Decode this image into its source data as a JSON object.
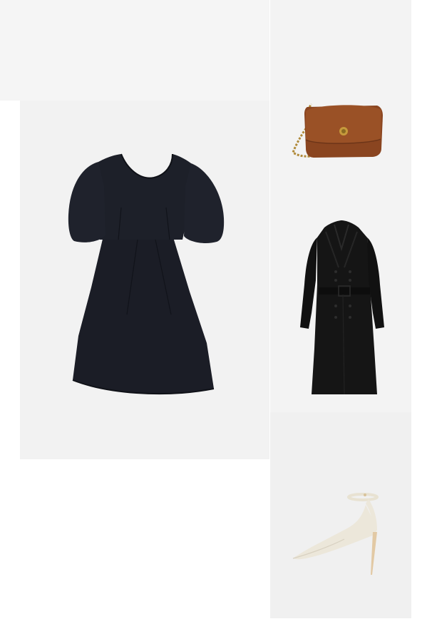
{
  "collage": {
    "items": [
      {
        "id": "dress",
        "icon": "black-dress-icon",
        "colors": {
          "garment": "#1b1d26",
          "background": "#f2f2f2"
        }
      },
      {
        "id": "bag",
        "icon": "brown-handbag-icon",
        "colors": {
          "leather": "#8a4520",
          "chain": "#b08a3a",
          "background": "#f3f3f3"
        }
      },
      {
        "id": "coat",
        "icon": "black-trench-coat-icon",
        "colors": {
          "garment": "#141414",
          "background": "#f3f3f3"
        }
      },
      {
        "id": "shoe",
        "icon": "ivory-pump-icon",
        "colors": {
          "leather": "#ece7da",
          "heel": "#e2c9a4",
          "background": "#f0f0f0"
        }
      }
    ]
  }
}
